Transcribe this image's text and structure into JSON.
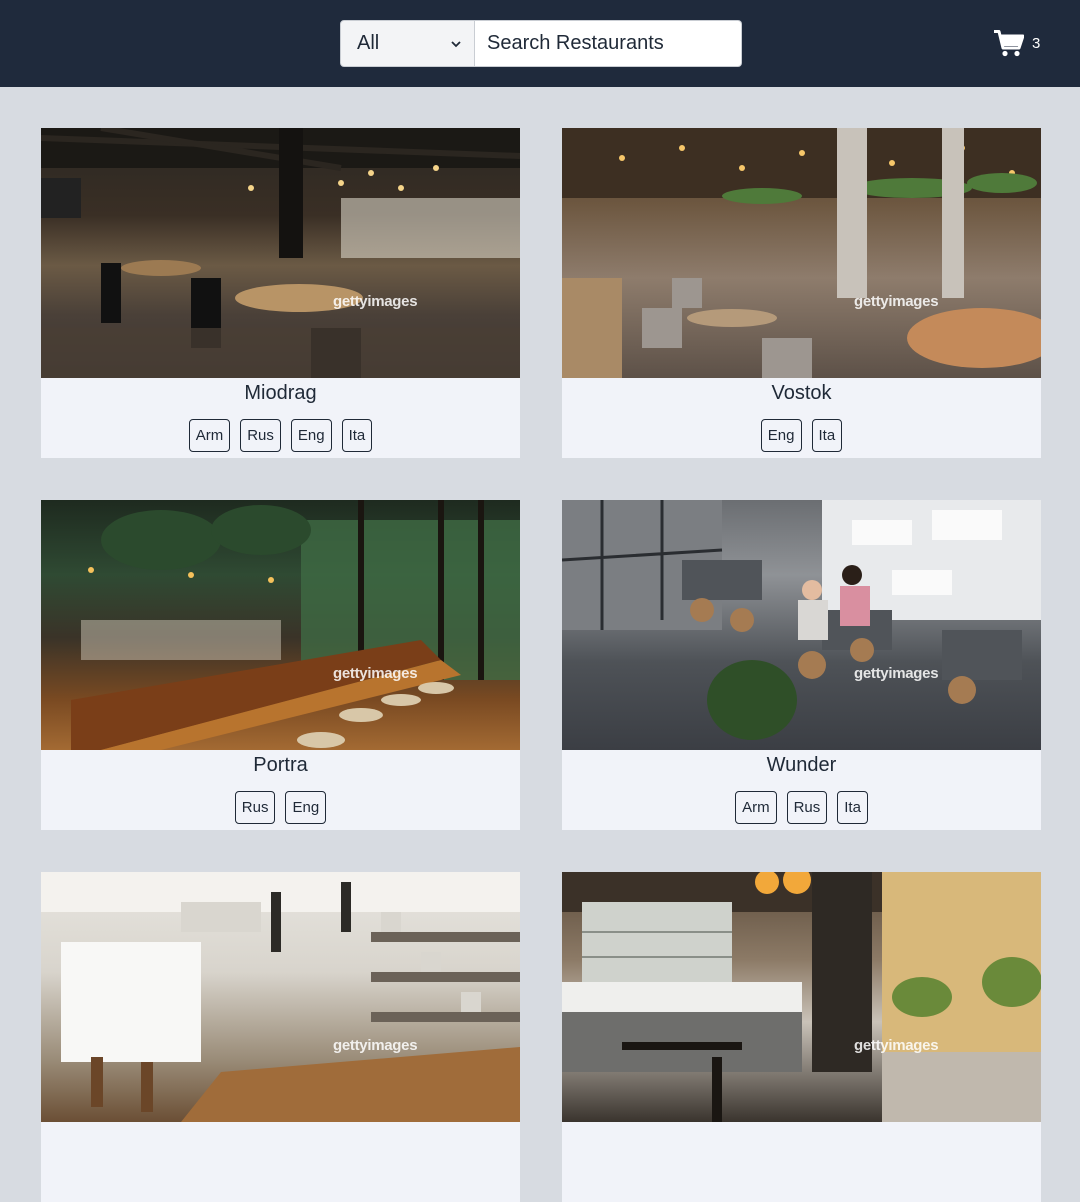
{
  "header": {
    "filter": {
      "selected": "All"
    },
    "search": {
      "placeholder": "Search Restaurants"
    },
    "cart": {
      "icon": "shopping-cart-icon",
      "count": "3"
    }
  },
  "colors": {
    "navbar": "#1f2a3c",
    "page_background": "#d7dbe1",
    "card_background": "#f1f3f9"
  },
  "restaurants": [
    {
      "name": "Miodrag",
      "languages": [
        "Arm",
        "Rus",
        "Eng",
        "Ita"
      ],
      "watermark": "gettyimages"
    },
    {
      "name": "Vostok",
      "languages": [
        "Eng",
        "Ita"
      ],
      "watermark": "gettyimages"
    },
    {
      "name": "Portra",
      "languages": [
        "Rus",
        "Eng"
      ],
      "watermark": "gettyimages"
    },
    {
      "name": "Wunder",
      "languages": [
        "Arm",
        "Rus",
        "Ita"
      ],
      "watermark": "gettyimages"
    },
    {
      "name": "",
      "languages": [],
      "watermark": "gettyimages"
    },
    {
      "name": "",
      "languages": [],
      "watermark": "gettyimages"
    }
  ]
}
